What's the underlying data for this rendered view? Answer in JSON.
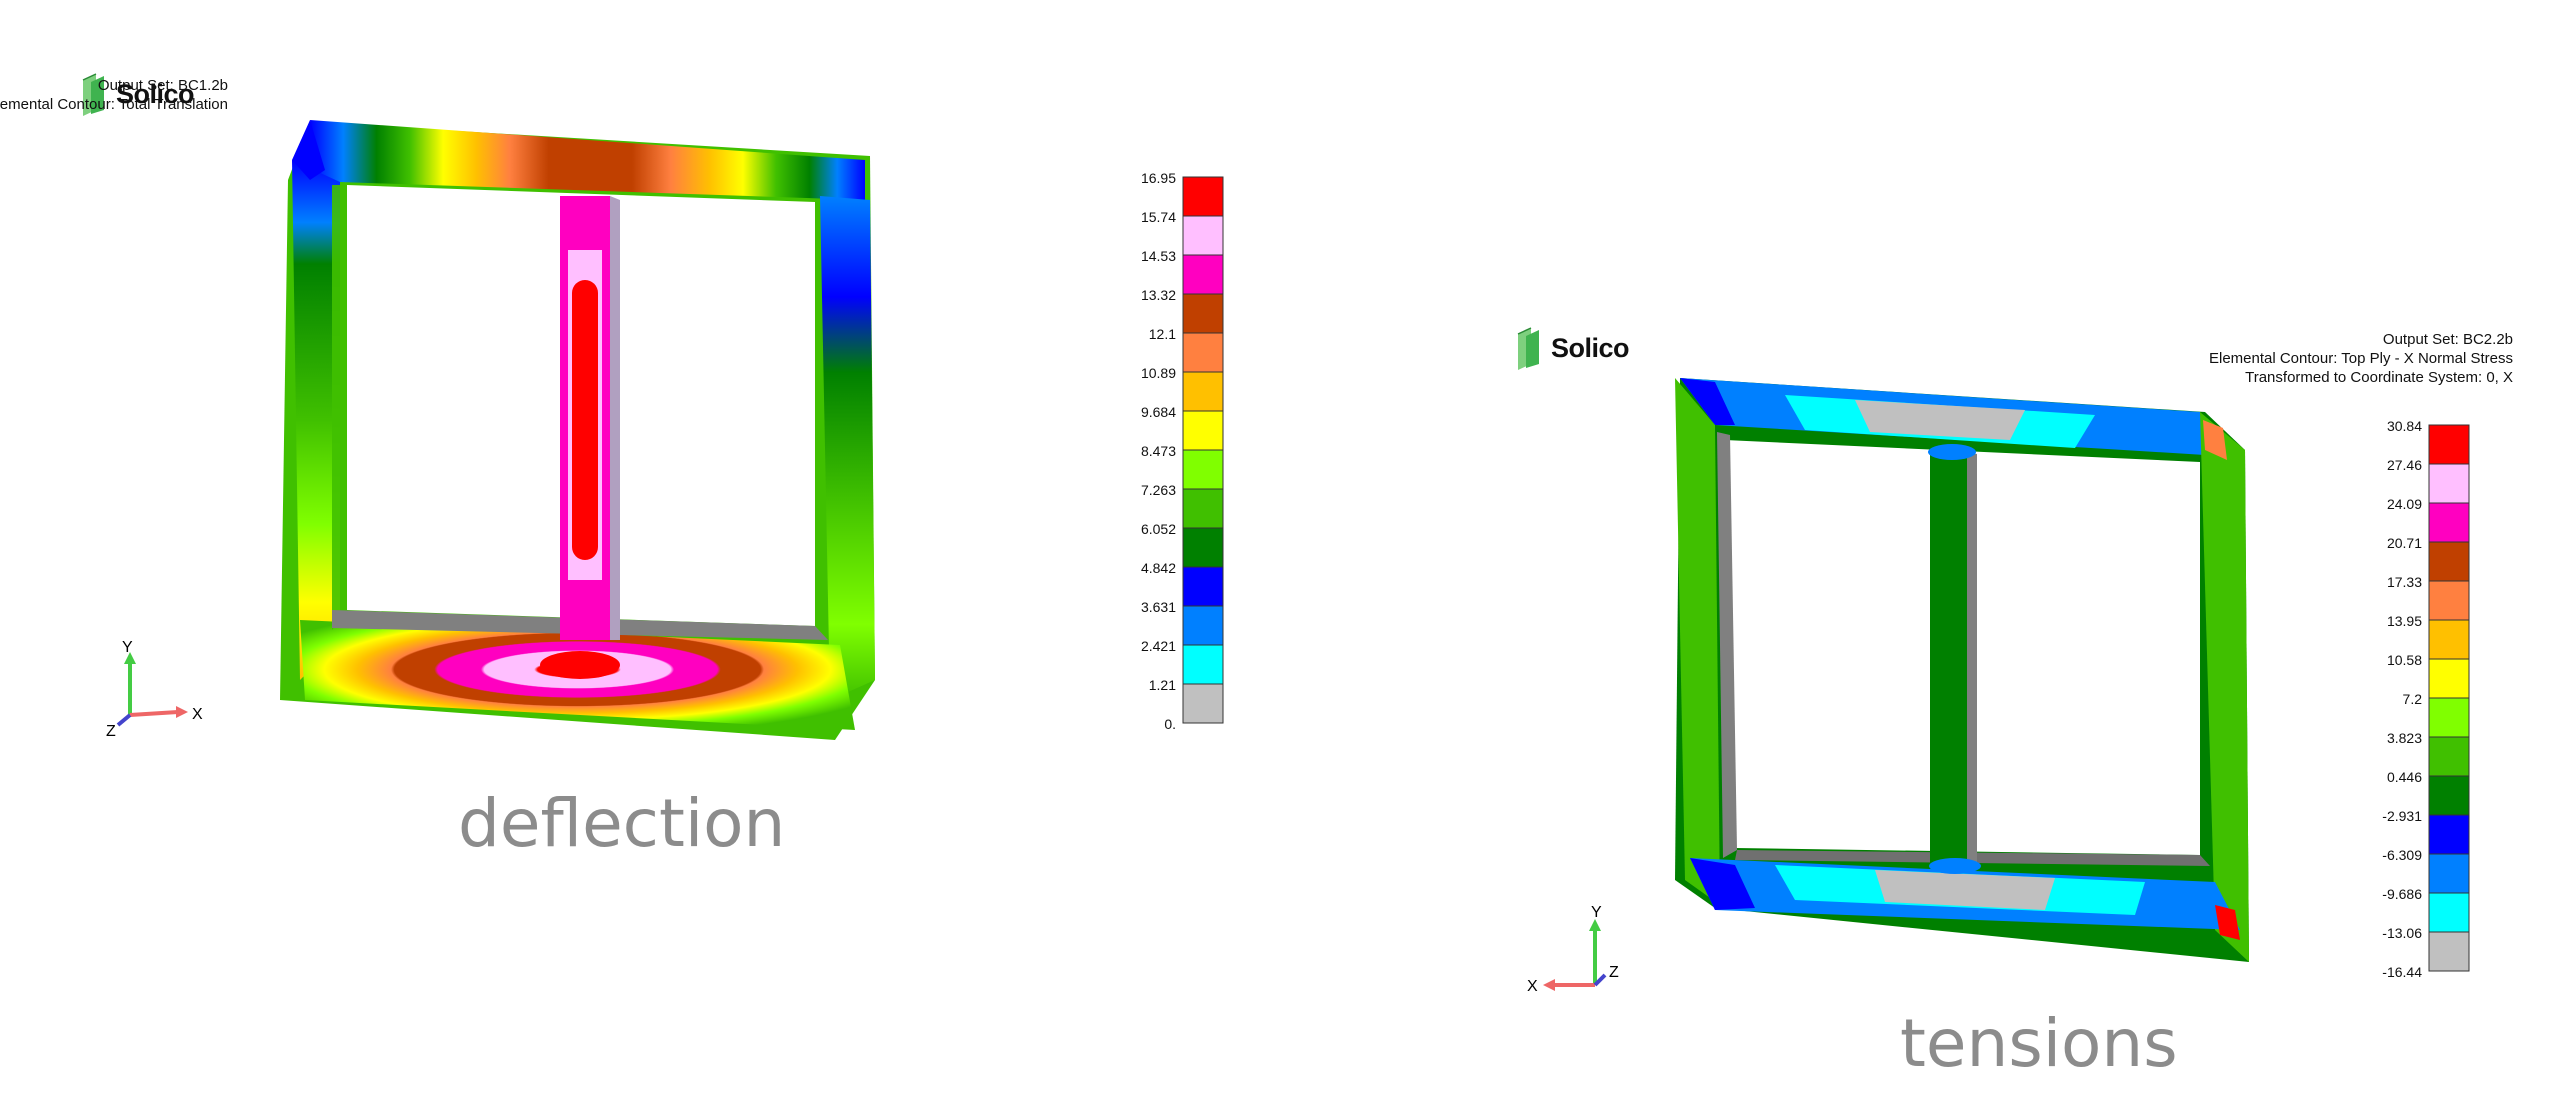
{
  "panels": [
    {
      "logo": "Solico",
      "header": [
        "Output Set: BC1.2b",
        "Elemental Contour: Total Translation"
      ],
      "scale_values": [
        "16.95",
        "15.74",
        "14.53",
        "13.32",
        "12.1",
        "10.89",
        "9.684",
        "8.473",
        "7.263",
        "6.052",
        "4.842",
        "3.631",
        "2.421",
        "1.21",
        "0."
      ],
      "scale_colors": [
        "#ff0000",
        "#ffbfff",
        "#ff00c0",
        "#c04000",
        "#ff8040",
        "#ffc000",
        "#ffff00",
        "#80ff00",
        "#40c000",
        "#008000",
        "#0000ff",
        "#0080ff",
        "#00ffff",
        "#c0c0c0"
      ],
      "caption": "deflection",
      "axes": {
        "x": "X",
        "y": "Y",
        "z": "Z"
      }
    },
    {
      "logo": "Solico",
      "header": [
        "Output Set: BC2.2b",
        "Elemental Contour: Top Ply - X Normal Stress",
        "Transformed to Coordinate System: 0, X"
      ],
      "scale_values": [
        "30.84",
        "27.46",
        "24.09",
        "20.71",
        "17.33",
        "13.95",
        "10.58",
        "7.2",
        "3.823",
        "0.446",
        "-2.931",
        "-6.309",
        "-9.686",
        "-13.06",
        "-16.44"
      ],
      "scale_colors": [
        "#ff0000",
        "#ffbfff",
        "#ff00c0",
        "#c04000",
        "#ff8040",
        "#ffc000",
        "#ffff00",
        "#80ff00",
        "#40c000",
        "#008000",
        "#0000ff",
        "#0080ff",
        "#00ffff",
        "#c0c0c0"
      ],
      "caption": "tensions",
      "axes": {
        "x": "X",
        "y": "Y",
        "z": "Z"
      }
    }
  ]
}
